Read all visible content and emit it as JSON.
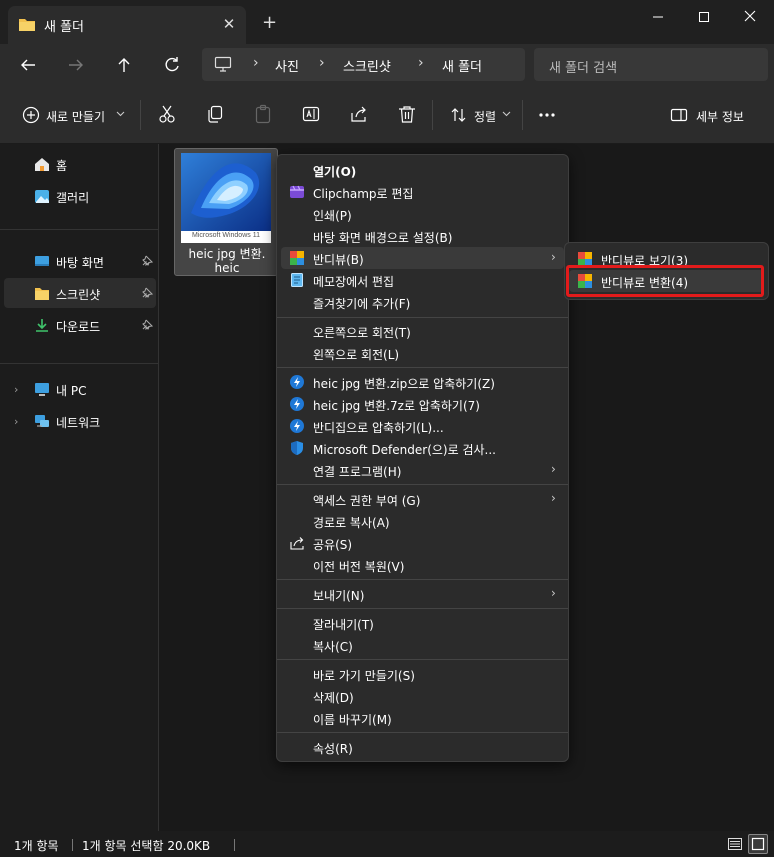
{
  "window": {
    "tab_title": "새 폴더",
    "close_tab": "✕",
    "new_tab": "+"
  },
  "breadcrumb": [
    "사진",
    "스크린샷",
    "새 폴더"
  ],
  "search": {
    "placeholder": "새 폴더 검색"
  },
  "toolbar": {
    "new_label": "새로 만들기",
    "sort_label": "정렬",
    "details_label": "세부 정보"
  },
  "sidebar": {
    "items": [
      {
        "label": "홈",
        "icon": "home-icon"
      },
      {
        "label": "갤러리",
        "icon": "gallery-icon"
      },
      {
        "label": "바탕 화면",
        "icon": "desktop-icon"
      },
      {
        "label": "스크린샷",
        "icon": "folder-icon"
      },
      {
        "label": "다운로드",
        "icon": "download-icon"
      },
      {
        "label": "내 PC",
        "icon": "pc-icon"
      },
      {
        "label": "네트워크",
        "icon": "network-icon"
      }
    ]
  },
  "file": {
    "name_line1": "heic jpg 변환.",
    "name_line2": "heic",
    "thumb_caption": "Microsoft Windows 11"
  },
  "context_menu": {
    "items": [
      {
        "label": "열기(O)",
        "bold": true
      },
      {
        "label": "Clipchamp로 편집",
        "icon": "clipchamp-icon"
      },
      {
        "label": "인쇄(P)"
      },
      {
        "label": "바탕 화면 배경으로 설정(B)"
      },
      {
        "label": "반디뷰(B)",
        "icon": "bandiview-icon",
        "submenu": true
      },
      {
        "label": "메모장에서 편집",
        "icon": "notepad-icon"
      },
      {
        "label": "즐겨찾기에 추가(F)"
      },
      {
        "label": "오른쪽으로 회전(T)"
      },
      {
        "label": "왼쪽으로 회전(L)"
      },
      {
        "label": "heic jpg 변환.zip으로 압축하기(Z)",
        "icon": "bandizip-icon"
      },
      {
        "label": "heic jpg 변환.7z로 압축하기(7)",
        "icon": "bandizip-icon"
      },
      {
        "label": "반디집으로 압축하기(L)...",
        "icon": "bandizip-icon"
      },
      {
        "label": "Microsoft Defender(으)로 검사...",
        "icon": "defender-icon"
      },
      {
        "label": "연결 프로그램(H)",
        "submenu": true
      },
      {
        "label": "액세스 권한 부여 (G)",
        "submenu": true
      },
      {
        "label": "경로로 복사(A)"
      },
      {
        "label": "공유(S)",
        "icon": "share-icon"
      },
      {
        "label": "이전 버전 복원(V)"
      },
      {
        "label": "보내기(N)",
        "submenu": true
      },
      {
        "label": "잘라내기(T)"
      },
      {
        "label": "복사(C)"
      },
      {
        "label": "바로 가기 만들기(S)"
      },
      {
        "label": "삭제(D)"
      },
      {
        "label": "이름 바꾸기(M)"
      },
      {
        "label": "속성(R)"
      }
    ],
    "submenu_arrow": "›"
  },
  "submenu": {
    "items": [
      {
        "label": "반디뷰로 보기(3)"
      },
      {
        "label": "반디뷰로 변환(4)"
      }
    ]
  },
  "statusbar": {
    "count": "1개 항목",
    "selected": "1개 항목 선택함 20.0KB"
  },
  "colors": {
    "highlight_box": "#e21b1b",
    "folder": "#f2c14e",
    "accent_blue": "#4cc2ff"
  }
}
